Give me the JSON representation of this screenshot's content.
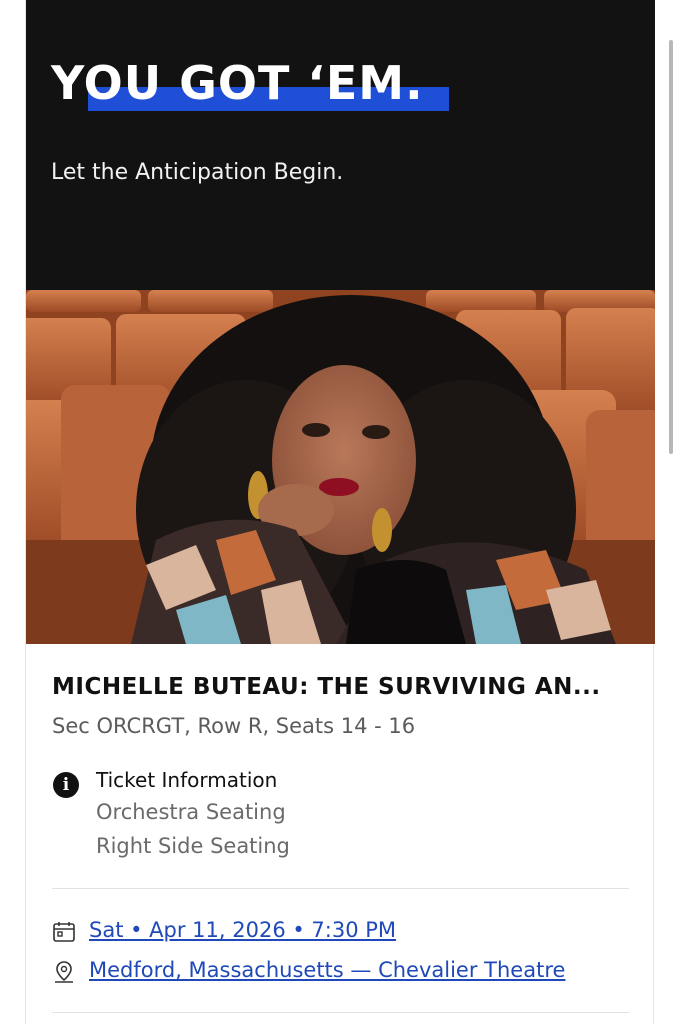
{
  "hero": {
    "title": "YOU GOT ‘EM.",
    "subtitle": "Let the Anticipation Begin."
  },
  "event": {
    "title": "MICHELLE BUTEAU: THE SURVIVING AN...",
    "seats": "Sec ORCRGT, Row R, Seats 14 - 16",
    "ticket_info": {
      "heading": "Ticket Information",
      "lines": [
        "Orchestra Seating",
        "Right Side Seating"
      ]
    },
    "date_link": "Sat • Apr 11, 2026 • 7:30 PM",
    "venue_link": "Medford, Massachusetts — Chevalier Theatre"
  },
  "icons": {
    "info": "info-icon",
    "date": "calendar-icon",
    "venue": "map-pin-icon"
  },
  "colors": {
    "hero_bg": "#121212",
    "accent_underline": "#1f4fd6",
    "link": "#1f49b8",
    "seat_orange": "#c86a3b"
  }
}
